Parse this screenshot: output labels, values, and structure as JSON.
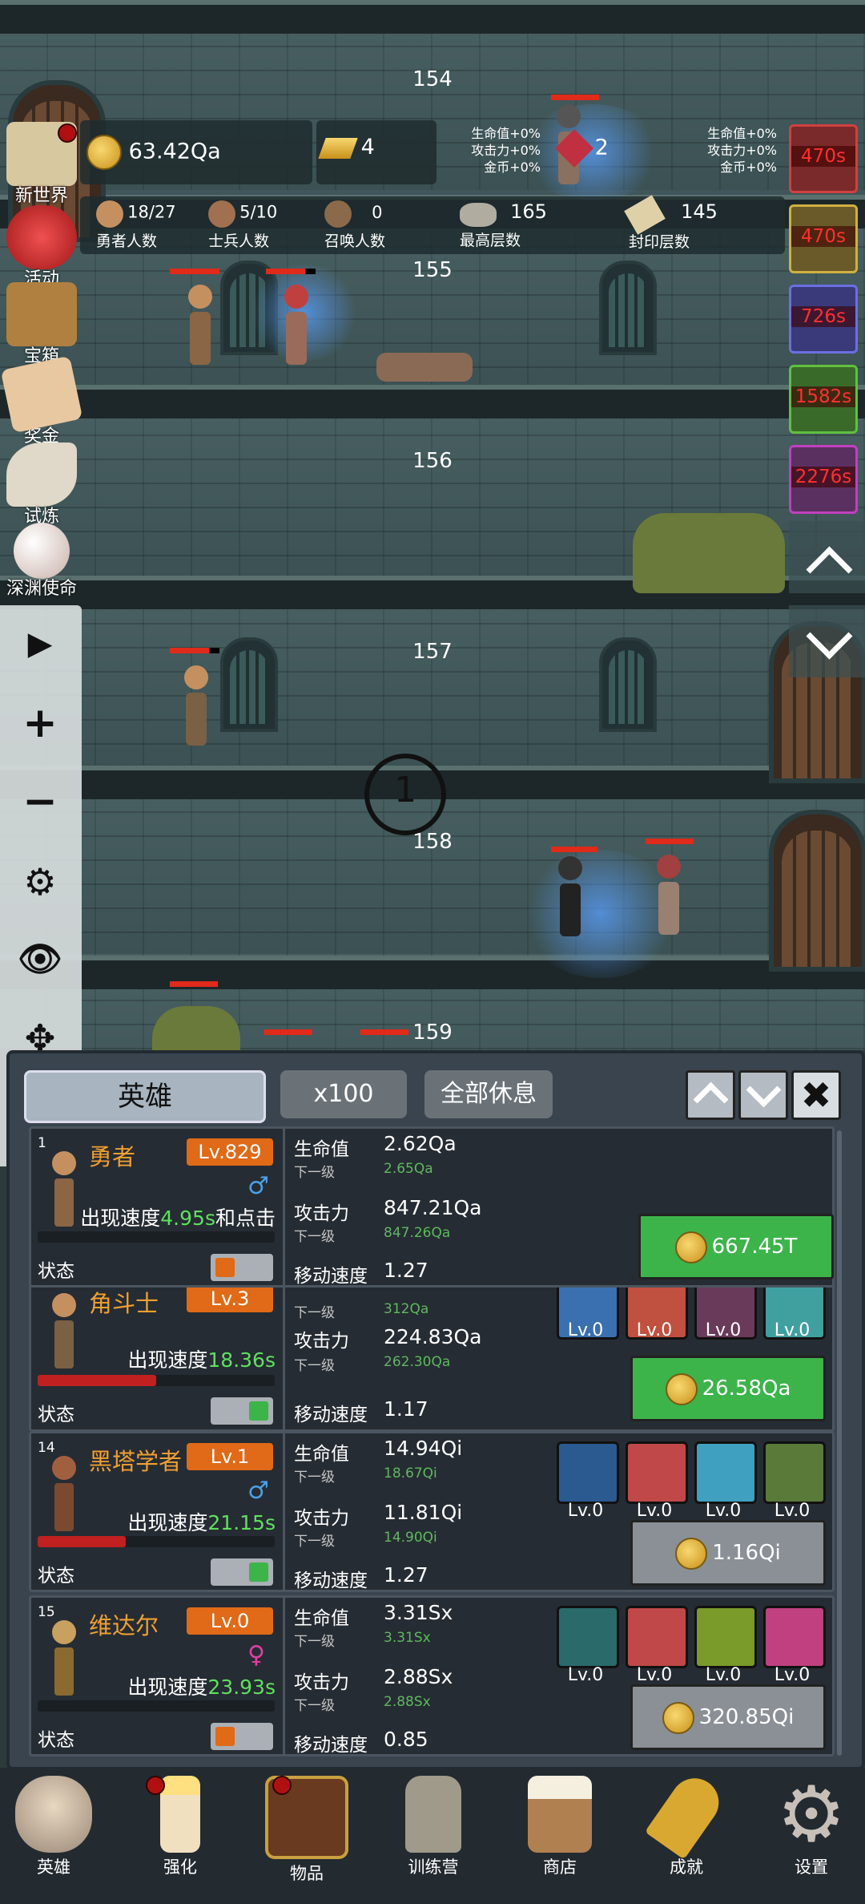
{
  "floors": [
    "154",
    "155",
    "156",
    "157",
    "158",
    "159"
  ],
  "top_stats": {
    "coins": "63.42Qa",
    "gold_bars": "4",
    "gems": "2",
    "bonus_left": [
      "生命值+0%",
      "攻击力+0%",
      "金币+0%"
    ],
    "bonus_right": [
      "生命值+0%",
      "攻击力+0%",
      "金币+0%"
    ],
    "hero_count": "18/27",
    "hero_count_label": "勇者人数",
    "soldier_count": "5/10",
    "soldier_count_label": "士兵人数",
    "summon_count": "0",
    "summon_count_label": "召唤人数",
    "max_floor": "165",
    "max_floor_label": "最高层数",
    "sealed_floor": "145",
    "sealed_floor_label": "封印层数"
  },
  "left_menu": [
    {
      "label": "新世界",
      "icon": "map-scroll-icon",
      "color": "#d8c8a0"
    },
    {
      "label": "活动",
      "icon": "heart-icon",
      "color": "#d03030"
    },
    {
      "label": "宝箱",
      "icon": "treasure-chest-icon",
      "color": "#b08040"
    },
    {
      "label": "奖金",
      "icon": "envelope-icon",
      "color": "#e8c8a0"
    },
    {
      "label": "试炼",
      "icon": "feather-icon",
      "color": "#e0d8c8"
    },
    {
      "label": "深渊使命",
      "icon": "pearl-icon",
      "color": "#e8d8d0"
    }
  ],
  "right_timers": [
    "470s",
    "470s",
    "726s",
    "1582s",
    "2276s"
  ],
  "crosshair_number": "1",
  "panel": {
    "tab_title": "英雄",
    "multiplier": "x100",
    "rest_all": "全部休息"
  },
  "heroes": [
    {
      "num": "1",
      "name": "勇者",
      "level": "Lv.829",
      "gender": "♂",
      "speed_prefix": "出现速度",
      "speed": "4.95s",
      "speed_suffix": "和点击",
      "hp_label": "生命值",
      "hp": "2.62Qa",
      "next_label": "下一级",
      "hp_next": "2.65Qa",
      "atk_label": "攻击力",
      "atk": "847.21Qa",
      "atk_next": "847.26Qa",
      "move_label": "移动速度",
      "move": "1.27",
      "status": "状态",
      "cost": "667.45T",
      "hp_bar": 0
    },
    {
      "num": "",
      "name": "角斗士",
      "level": "Lv.3",
      "gender": "",
      "speed_prefix": "出现速度",
      "speed": "18.36s",
      "speed_suffix": "",
      "hp_label": "",
      "hp": "",
      "next_label": "下一级",
      "hp_next": "312Qa",
      "atk_label": "攻击力",
      "atk": "224.83Qa",
      "atk_next": "262.30Qa",
      "move_label": "移动速度",
      "move": "1.17",
      "status": "状态",
      "cost": "26.58Qa",
      "skills": [
        "Lv.0",
        "Lv.0",
        "Lv.0",
        "Lv.0"
      ],
      "hp_bar": 0.5
    },
    {
      "num": "14",
      "name": "黑塔学者",
      "level": "Lv.1",
      "gender": "♂",
      "speed_prefix": "出现速度",
      "speed": "21.15s",
      "speed_suffix": "",
      "hp_label": "生命值",
      "hp": "14.94Qi",
      "next_label": "下一级",
      "hp_next": "18.67Qi",
      "atk_label": "攻击力",
      "atk": "11.81Qi",
      "atk_next": "14.90Qi",
      "move_label": "移动速度",
      "move": "1.27",
      "status": "状态",
      "cost": "1.16Qi",
      "skills": [
        "Lv.0",
        "Lv.0",
        "Lv.0",
        "Lv.0"
      ],
      "hp_bar": 0.37
    },
    {
      "num": "15",
      "name": "维达尔",
      "level": "Lv.0",
      "gender": "♀",
      "speed_prefix": "出现速度",
      "speed": "23.93s",
      "speed_suffix": "",
      "hp_label": "生命值",
      "hp": "3.31Sx",
      "next_label": "下一级",
      "hp_next": "3.31Sx",
      "atk_label": "攻击力",
      "atk": "2.88Sx",
      "atk_next": "2.88Sx",
      "move_label": "移动速度",
      "move": "0.85",
      "status": "状态",
      "cost": "320.85Qi",
      "skills": [
        "Lv.0",
        "Lv.0",
        "Lv.0",
        "Lv.0"
      ],
      "hp_bar": 0
    }
  ],
  "nav": [
    {
      "label": "英雄",
      "icon": "skull-icon"
    },
    {
      "label": "强化",
      "icon": "candle-icon"
    },
    {
      "label": "物品",
      "icon": "book-icon"
    },
    {
      "label": "训练营",
      "icon": "lantern-icon"
    },
    {
      "label": "商店",
      "icon": "beer-mug-icon"
    },
    {
      "label": "成就",
      "icon": "key-icon"
    },
    {
      "label": "设置",
      "icon": "gear-icon"
    }
  ],
  "colors": {
    "accent_orange": "#e06a18",
    "buy_green": "#3cb44a",
    "speed_green": "#5fe05f",
    "timer_red": "#ff3030"
  }
}
